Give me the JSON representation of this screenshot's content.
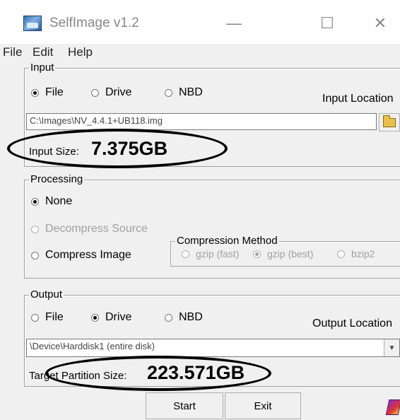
{
  "window": {
    "title": "SelfImage v1.2",
    "controls": {
      "minimize": "—",
      "maximize": "☐",
      "close": "✕"
    }
  },
  "menu": [
    "File",
    "Edit",
    "Help"
  ],
  "input": {
    "group_label": "Input",
    "options": [
      "File",
      "Drive",
      "NBD"
    ],
    "selected": "File",
    "location_label": "Input Location",
    "path": "C:\\Images\\NV_4.4.1+UB118.img",
    "size_label": "Input Size:",
    "size_value": "7.375GB"
  },
  "processing": {
    "group_label": "Processing",
    "none": "None",
    "decompress": "Decompress Source",
    "compress": "Compress Image",
    "selected": "None",
    "compression": {
      "group_label": "Compression Method",
      "options": [
        "gzip (fast)",
        "gzip (best)",
        "bzip2"
      ],
      "selected": "gzip (best)"
    }
  },
  "output": {
    "group_label": "Output",
    "options": [
      "File",
      "Drive",
      "NBD"
    ],
    "selected": "Drive",
    "location_label": "Output Location",
    "device": "\\Device\\Harddisk1 (entire disk)",
    "size_label": "Target Partition Size:",
    "size_value": "223.571GB"
  },
  "buttons": {
    "start": "Start",
    "exit": "Exit"
  },
  "icons": {
    "app": "selfimage-app-icon",
    "browse": "folder-open-icon",
    "dropdown": "chevron-down-icon",
    "about": "book-icon"
  }
}
